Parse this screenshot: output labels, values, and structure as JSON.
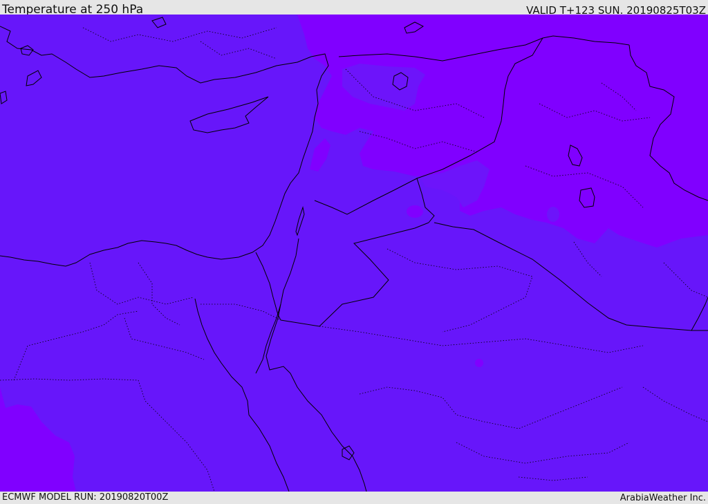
{
  "header": {
    "title": "Temperature at 250 hPa",
    "valid": "VALID T+123 SUN. 20190825T03Z"
  },
  "footer": {
    "model_run": "ECMWF MODEL RUN: 20190820T00Z",
    "credit": "ArabiaWeather Inc."
  },
  "map": {
    "colors": {
      "base_fill": "#6716fa",
      "warm_fill": "#8000ff",
      "mid_fill": "#7410fb",
      "coastline": "#000000",
      "border_dotted": "#000000"
    }
  }
}
